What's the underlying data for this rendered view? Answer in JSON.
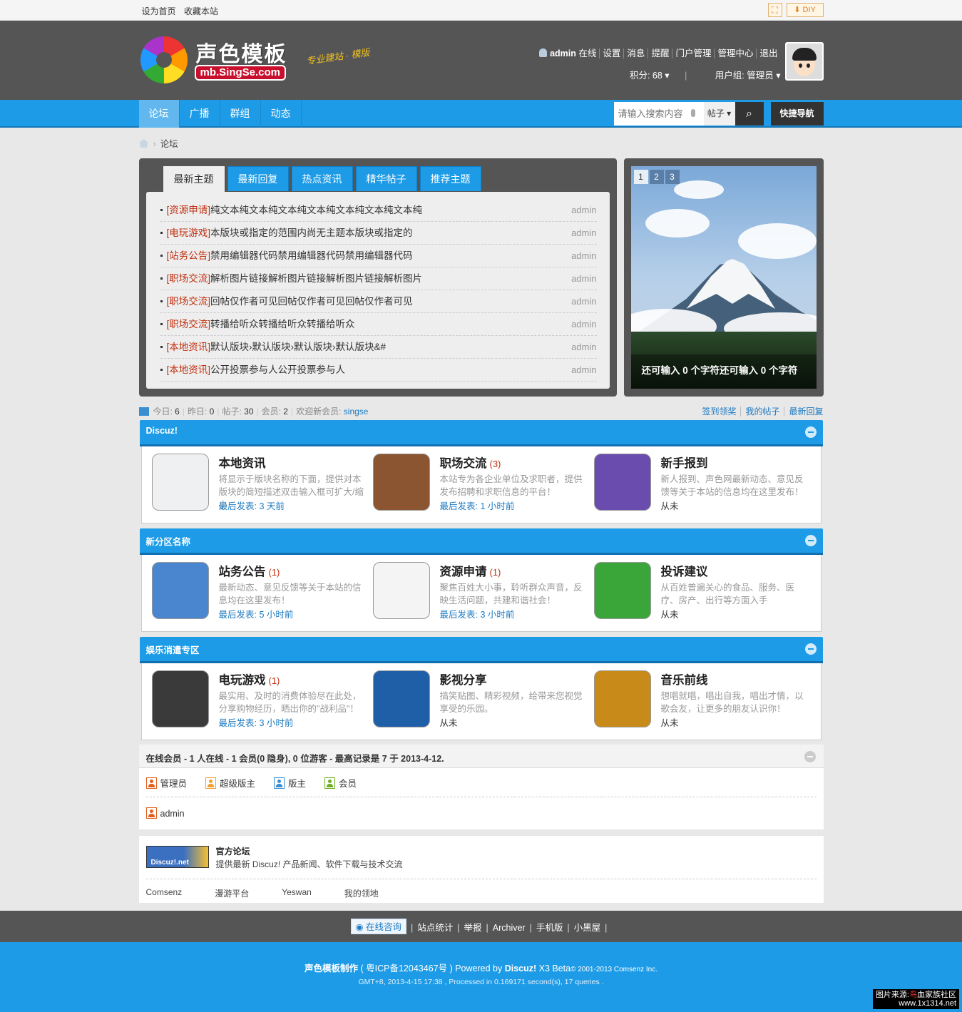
{
  "topbar": {
    "set_home": "设为首页",
    "bookmark": "收藏本站",
    "diy": "DIY"
  },
  "header": {
    "logo_text": "声色模板",
    "logo_url": "mb.SingSe.com",
    "slogan": "专业建站 · 模版",
    "username": "admin",
    "status": "在线",
    "links": [
      "设置",
      "消息",
      "提醒",
      "门户管理",
      "管理中心",
      "退出"
    ],
    "points": "积分: 68",
    "usergroup": "用户组: 管理员"
  },
  "nav": {
    "items": [
      "论坛",
      "广播",
      "群组",
      "动态"
    ],
    "search_placeholder": "请输入搜索内容",
    "search_type": "帖子",
    "quick_nav": "快捷导航"
  },
  "breadcrumb": {
    "current": "论坛"
  },
  "tabs": [
    "最新主题",
    "最新回复",
    "热点资讯",
    "精华帖子",
    "推荐主题"
  ],
  "topics": [
    {
      "cat": "[资源申请]",
      "title": "纯文本纯文本纯文本纯文本纯文本纯文本纯文本纯",
      "author": "admin"
    },
    {
      "cat": "[电玩游戏]",
      "title": "本版块或指定的范围内尚无主题本版块或指定的",
      "author": "admin"
    },
    {
      "cat": "[站务公告]",
      "title": "禁用编辑器代码禁用编辑器代码禁用编辑器代码",
      "author": "admin"
    },
    {
      "cat": "[职场交流]",
      "title": "解析图片链接解析图片链接解析图片链接解析图片",
      "author": "admin"
    },
    {
      "cat": "[职场交流]",
      "title": "回帖仅作者可见回帖仅作者可见回帖仅作者可见",
      "author": "admin"
    },
    {
      "cat": "[职场交流]",
      "title": "转播给听众转播给听众转播给听众",
      "author": "admin"
    },
    {
      "cat": "[本地资讯]",
      "title": "默认版块›默认版块›默认版块›默认版块&#",
      "author": "admin"
    },
    {
      "cat": "[本地资讯]",
      "title": "公开投票参与人公开投票参与人",
      "author": "admin"
    }
  ],
  "slider": {
    "pages": [
      "1",
      "2",
      "3"
    ],
    "caption": "还可输入 0 个字符还可输入 0 个字符"
  },
  "stats": {
    "today": "今日: ",
    "today_v": "6",
    "yesterday": "昨日: ",
    "yesterday_v": "0",
    "posts": "帖子: ",
    "posts_v": "30",
    "members": "会员: ",
    "members_v": "2",
    "welcome": "欢迎新会员: ",
    "newest": "singse",
    "links": [
      "签到领奖",
      "我的帖子",
      "最新回复"
    ]
  },
  "sections": [
    {
      "title": "Discuz!",
      "forums": [
        {
          "name": "本地资讯",
          "count": "",
          "desc": "将显示于版块名称的下面，提供对本版块的简短描述双击输入框可扩大/缩小",
          "last": "最后发表: 3 天前",
          "icon_color": "#eef0f2"
        },
        {
          "name": "职场交流",
          "count": "(3)",
          "desc": "本站专为各企业单位及求职者，提供发布招聘和求职信息的平台！",
          "last": "最后发表: 1 小时前",
          "icon_color": "#8a5530"
        },
        {
          "name": "新手报到",
          "count": "",
          "desc": "新人报到、声色网最新动态、意见反馈等关于本站的信息均在这里发布！",
          "last": "从未",
          "icon_color": "#6a4cae"
        }
      ]
    },
    {
      "title": "新分区名称",
      "forums": [
        {
          "name": "站务公告",
          "count": "(1)",
          "desc": "最新动态、意见反馈等关于本站的信息均在这里发布！",
          "last": "最后发表: 5 小时前",
          "icon_color": "#4a86d0"
        },
        {
          "name": "资源申请",
          "count": "(1)",
          "desc": "聚焦百姓大小事，聆听群众声音，反映生活问题，共建和谐社会！",
          "last": "最后发表: 3 小时前",
          "icon_color": "#f4f4f4"
        },
        {
          "name": "投诉建议",
          "count": "",
          "desc": "从百姓普遍关心的食品、服务、医疗、房产、出行等方面入手",
          "last": "从未",
          "icon_color": "#3aa63a"
        }
      ]
    },
    {
      "title": "娱乐消遣专区",
      "forums": [
        {
          "name": "电玩游戏",
          "count": "(1)",
          "desc": "最实用、及时的消费体验尽在此处，分享购物经历，晒出你的\"战利品\"！",
          "last": "最后发表: 3 小时前",
          "icon_color": "#3a3a3a"
        },
        {
          "name": "影视分享",
          "count": "",
          "desc": "搞笑贴图、精彩视频，给带来您视觉享受的乐园。",
          "last": "从未",
          "icon_color": "#1f5fa8"
        },
        {
          "name": "音乐前线",
          "count": "",
          "desc": "想唱就唱，唱出自我，唱出才情，以歌会友，让更多的朋友认识你！",
          "last": "从未",
          "icon_color": "#c88a18"
        }
      ]
    }
  ],
  "online": {
    "title": "在线会员 - 1 人在线 - 1 会员(0 隐身), 0 位游客 - 最高记录是 7 于 2013-4-12.",
    "legend": [
      {
        "label": "管理员",
        "color": "#e06020"
      },
      {
        "label": "超级版主",
        "color": "#f0a030"
      },
      {
        "label": "版主",
        "color": "#3a8fd2"
      },
      {
        "label": "会员",
        "color": "#70b020"
      }
    ],
    "users": [
      "admin"
    ]
  },
  "links": {
    "logo_text": "Discuz!.net",
    "title": "官方论坛",
    "desc": "提供最新 Discuz! 产品新闻、软件下载与技术交流",
    "friends": [
      "Comsenz",
      "漫游平台",
      "Yeswan",
      "我的领地"
    ]
  },
  "footbar": {
    "consult": "在线咨询",
    "items": [
      "站点统计",
      "举报",
      "Archiver",
      "手机版",
      "小黑屋"
    ]
  },
  "footer": {
    "line1_a": "声色模板制作",
    "line1_b": " ( 粤ICP备12043467号 ) Powered by ",
    "line1_c": "Discuz!",
    "line1_d": " X3 Beta",
    "line1_e": "© 2001-2013 Comsenz Inc.",
    "line2": "GMT+8, 2013-4-15 17:38 , Processed in 0.169171 second(s), 17 queries ."
  },
  "watermark": {
    "line1_a": "图片来源:",
    "line1_b": "鸟",
    "line1_c": "血家族社区",
    "line2": "www.1x1314.net"
  }
}
